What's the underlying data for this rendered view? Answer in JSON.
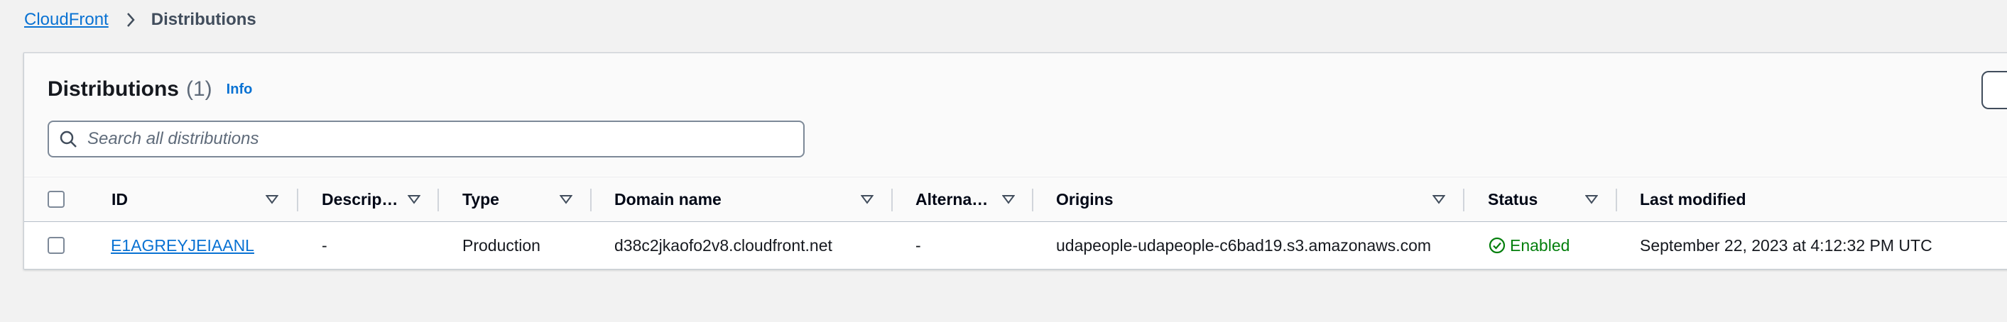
{
  "breadcrumb": {
    "root": "CloudFront",
    "current": "Distributions"
  },
  "header": {
    "title": "Distributions",
    "count": "(1)",
    "info": "Info"
  },
  "search": {
    "placeholder": "Search all distributions",
    "value": ""
  },
  "columns": [
    "ID",
    "Descrip…",
    "Type",
    "Domain name",
    "Alterna…",
    "Origins",
    "Status",
    "Last modified"
  ],
  "rows": [
    {
      "id": "E1AGREYJEIAANL",
      "description": "-",
      "type": "Production",
      "domain": "d38c2jkaofo2v8.cloudfront.net",
      "alternate": "-",
      "origins": "udapeople-udapeople-c6bad19.s3.amazonaws.com",
      "status": "Enabled",
      "last_modified": "September 22, 2023 at 4:12:32 PM UTC"
    }
  ],
  "colors": {
    "link": "#0972d3",
    "success": "#037f0c",
    "border": "#7d8998"
  },
  "icons": [
    "chevron-right-icon",
    "search-icon",
    "sort-caret-icon",
    "status-positive-icon"
  ]
}
